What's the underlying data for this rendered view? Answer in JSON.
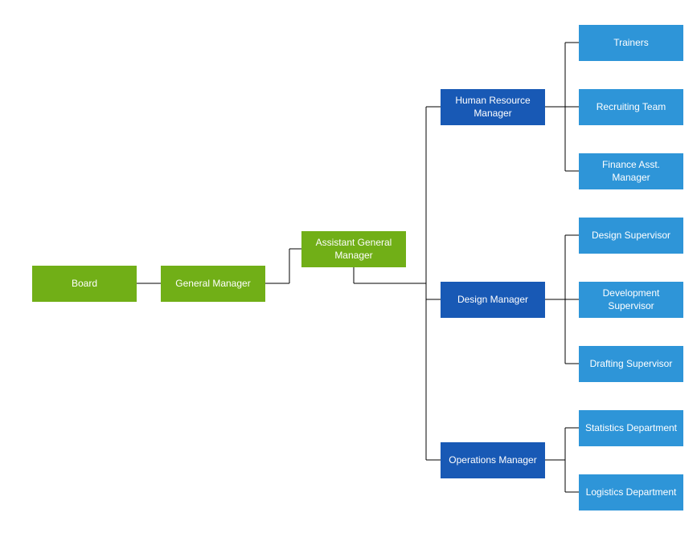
{
  "chart_data": {
    "type": "org-hierarchy",
    "root": {
      "label": "Board",
      "color": "green",
      "children": [
        {
          "label": "General Manager",
          "color": "green",
          "children": [
            {
              "label": "Assistant General Manager",
              "color": "green",
              "children": [
                {
                  "label": "Human Resource Manager",
                  "color": "darkblue",
                  "children": [
                    {
                      "label": "Trainers",
                      "color": "lightblue"
                    },
                    {
                      "label": "Recruiting Team",
                      "color": "lightblue"
                    },
                    {
                      "label": "Finance Asst. Manager",
                      "color": "lightblue"
                    }
                  ]
                },
                {
                  "label": "Design Manager",
                  "color": "darkblue",
                  "children": [
                    {
                      "label": "Design Supervisor",
                      "color": "lightblue"
                    },
                    {
                      "label": "Development Supervisor",
                      "color": "lightblue"
                    },
                    {
                      "label": "Drafting Supervisor",
                      "color": "lightblue"
                    }
                  ]
                },
                {
                  "label": "Operations Manager",
                  "color": "darkblue",
                  "children": [
                    {
                      "label": "Statistics Department",
                      "color": "lightblue"
                    },
                    {
                      "label": "Logistics Department",
                      "color": "lightblue"
                    }
                  ]
                }
              ]
            }
          ]
        }
      ]
    }
  },
  "colors": {
    "green": "#71AF17",
    "darkblue": "#1859B5",
    "lightblue": "#2E95D8"
  },
  "nodes": {
    "board": "Board",
    "general_manager": "General Manager",
    "assistant_general_manager": "Assistant General Manager",
    "hr_manager": "Human Resource Manager",
    "design_manager": "Design Manager",
    "operations_manager": "Operations Manager",
    "trainers": "Trainers",
    "recruiting_team": "Recruiting Team",
    "finance_asst_manager": "Finance Asst. Manager",
    "design_supervisor": "Design Supervisor",
    "development_supervisor": "Development Supervisor",
    "drafting_supervisor": "Drafting Supervisor",
    "statistics_department": "Statistics Department",
    "logistics_department": "Logistics Department"
  }
}
